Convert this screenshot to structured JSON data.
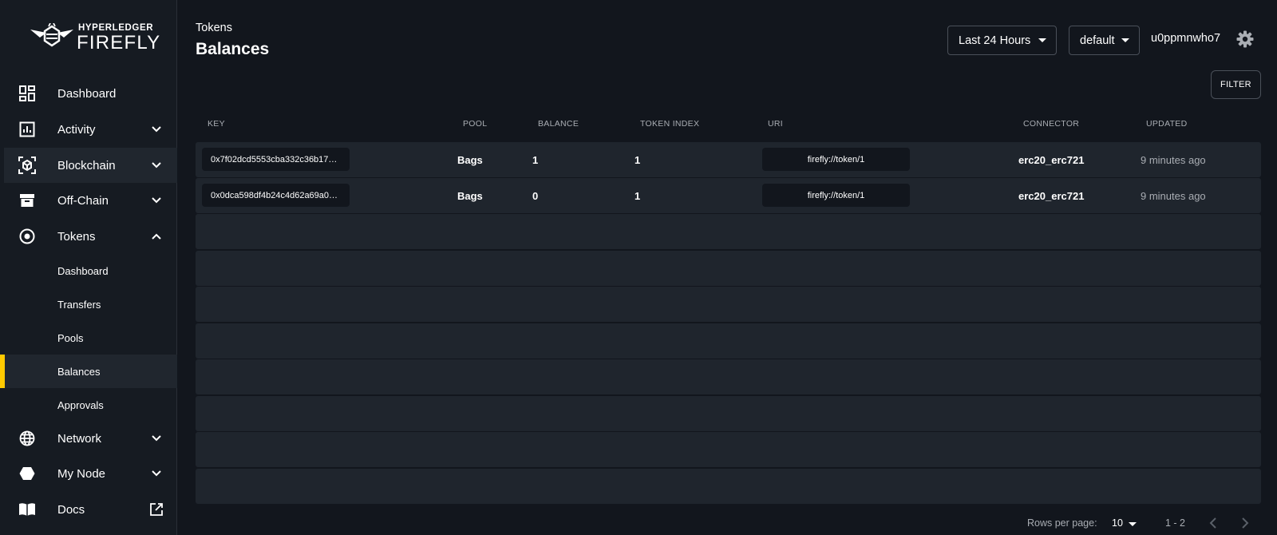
{
  "brand": {
    "line1": "HYPERLEDGER",
    "line2": "FIREFLY"
  },
  "sidebar": {
    "items": [
      {
        "label": "Dashboard",
        "icon": "dashboard-icon"
      },
      {
        "label": "Activity",
        "icon": "activity-chart-icon"
      },
      {
        "label": "Blockchain",
        "icon": "blockchain-cube-icon"
      },
      {
        "label": "Off-Chain",
        "icon": "archive-box-icon"
      },
      {
        "label": "Tokens",
        "icon": "token-circle-icon"
      },
      {
        "label": "Network",
        "icon": "globe-icon"
      },
      {
        "label": "My Node",
        "icon": "hexagon-node-icon"
      },
      {
        "label": "Docs",
        "icon": "book-icon"
      }
    ],
    "token_sub": [
      {
        "label": "Dashboard"
      },
      {
        "label": "Transfers"
      },
      {
        "label": "Pools"
      },
      {
        "label": "Balances"
      },
      {
        "label": "Approvals"
      }
    ]
  },
  "header": {
    "breadcrumb": "Tokens",
    "title": "Balances",
    "time_range": "Last 24 Hours",
    "namespace": "default",
    "user": "u0ppmnwho7"
  },
  "toolbar": {
    "filter_label": "FILTER"
  },
  "table": {
    "columns": [
      "KEY",
      "POOL",
      "BALANCE",
      "TOKEN INDEX",
      "URI",
      "CONNECTOR",
      "UPDATED"
    ],
    "rows": [
      {
        "key": "0x7f02dcd5553cba332c36b17…",
        "pool": "Bags",
        "balance": "1",
        "token_index": "1",
        "uri": "firefly://token/1",
        "connector": "erc20_erc721",
        "updated": "9 minutes ago"
      },
      {
        "key": "0x0dca598df4b24c4d62a69a0…",
        "pool": "Bags",
        "balance": "0",
        "token_index": "1",
        "uri": "firefly://token/1",
        "connector": "erc20_erc721",
        "updated": "9 minutes ago"
      }
    ]
  },
  "pagination": {
    "rows_per_page_label": "Rows per page:",
    "rows_per_page": "10",
    "range": "1 - 2"
  },
  "colors": {
    "accent": "#ffca00",
    "background": "#12161d",
    "sidebar": "#161b22",
    "row": "#1f252d"
  }
}
